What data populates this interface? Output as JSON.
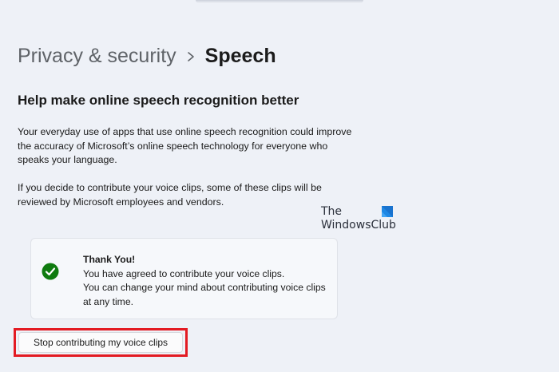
{
  "breadcrumb": {
    "parent": "Privacy & security",
    "separator_icon": "chevron-right-icon",
    "current": "Speech"
  },
  "section": {
    "heading": "Help make online speech recognition better",
    "paragraph_1": "Your everyday use of apps that use online speech recognition could improve the accuracy of Microsoft’s online speech technology for everyone who speaks your language.",
    "paragraph_2": "If you decide to contribute your voice clips, some of these clips will be reviewed by Microsoft employees and vendors."
  },
  "watermark": {
    "line_1": "The",
    "line_2": "WindowsClub"
  },
  "status_card": {
    "icon": "checkmark-circle-icon",
    "title": "Thank You!",
    "line_1": "You have agreed to contribute your voice clips.",
    "line_2": "You can change your mind about contributing voice clips at any time."
  },
  "actions": {
    "stop_label": "Stop contributing my voice clips"
  },
  "colors": {
    "background": "#eef1f7",
    "success_green": "#0f7b0f",
    "highlight_red": "#e31b23"
  }
}
